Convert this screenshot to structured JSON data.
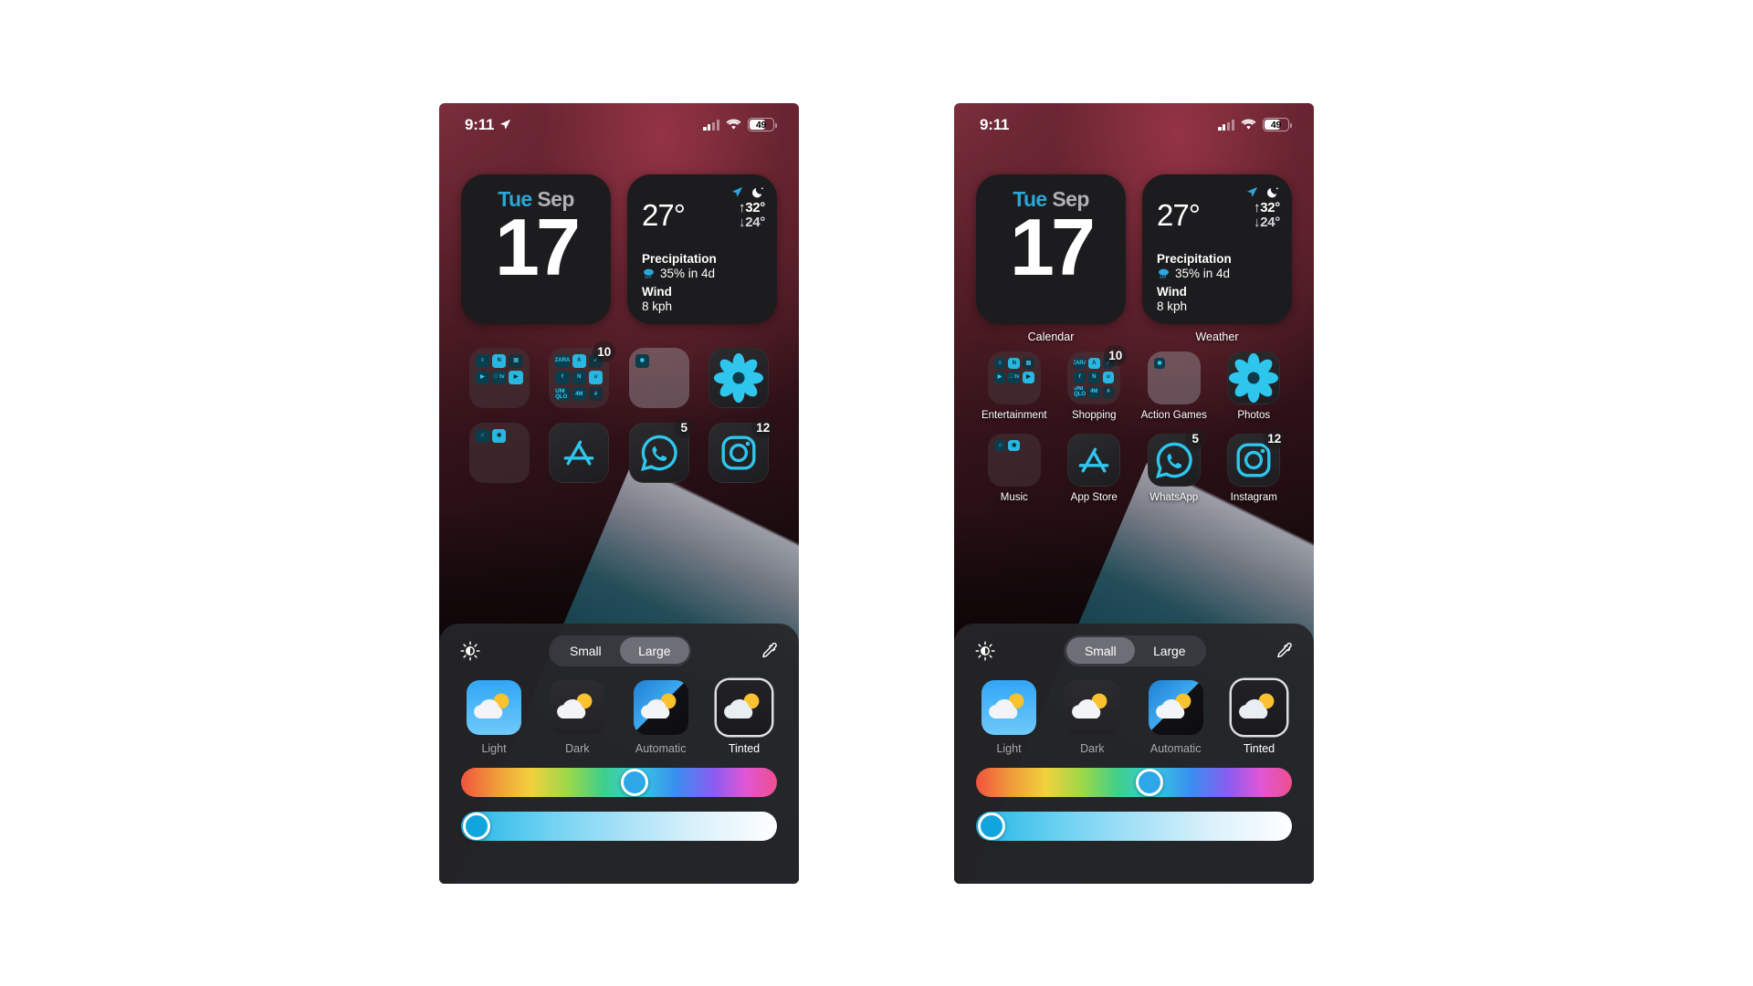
{
  "screens": [
    {
      "id": "left",
      "name": "home-screen-large-icons-no-labels",
      "status_bar": {
        "time": "9:11",
        "location_icon": "location-arrow-icon",
        "signal_icon": "cellular-signal-icon",
        "wifi_icon": "wifi-icon",
        "battery_level": "49"
      },
      "widgets": [
        {
          "name": "calendar-widget",
          "label": "",
          "day_of_week": "Tue",
          "month": "Sep",
          "day": "17"
        },
        {
          "name": "weather-widget",
          "label": "",
          "temperature": "27°",
          "high": "↑32°",
          "low": "↓24°",
          "precipitation_title": "Precipitation",
          "precipitation_value": "35% in 4d",
          "wind_title": "Wind",
          "wind_value": "8 kph",
          "location_icon": "location-arrow-icon",
          "condition_icon": "moon-stars-icon",
          "precip_icon": "rain-cloud-icon"
        }
      ],
      "apps": [
        {
          "name": "entertainment-folder",
          "label": "",
          "badge": "",
          "type": "folder",
          "tiles": [
            "≡",
            "N",
            "▤",
            "▶",
            " tv",
            "▶",
            "",
            "",
            ""
          ]
        },
        {
          "name": "shopping-folder",
          "label": "",
          "badge": "10",
          "type": "folder",
          "tiles": [
            "ZARA",
            "Λ",
            "✓",
            "f",
            "N",
            "∪",
            "UNI QLO",
            "4M",
            "#"
          ]
        },
        {
          "name": "action-games-folder",
          "label": "",
          "badge": "",
          "type": "folder-light",
          "tiles": [
            "◉",
            "",
            "",
            "",
            "",
            "",
            "",
            "",
            ""
          ]
        },
        {
          "name": "photos-app",
          "label": "",
          "badge": "",
          "type": "photos"
        },
        {
          "name": "music-folder",
          "label": "",
          "badge": "",
          "type": "folder",
          "tiles": [
            "♫",
            "◉",
            "",
            "",
            "",
            "",
            "",
            "",
            ""
          ]
        },
        {
          "name": "app-store-app",
          "label": "",
          "badge": "",
          "type": "appstore"
        },
        {
          "name": "whatsapp-app",
          "label": "",
          "badge": "5",
          "type": "whatsapp"
        },
        {
          "name": "instagram-app",
          "label": "",
          "badge": "12",
          "type": "instagram"
        }
      ],
      "panel": {
        "brightness_icon": "brightness-icon",
        "eyedropper_icon": "eyedropper-icon",
        "size_options": [
          "Small",
          "Large"
        ],
        "size_selected": "Large",
        "themes": [
          {
            "name": "Light",
            "selected": false
          },
          {
            "name": "Dark",
            "selected": false
          },
          {
            "name": "Automatic",
            "selected": false
          },
          {
            "name": "Tinted",
            "selected": true
          }
        ],
        "hue_slider": {
          "name": "hue-slider",
          "position_pct": 55
        },
        "luminance_slider": {
          "name": "luminance-slider",
          "position_pct": 5
        }
      }
    },
    {
      "id": "right",
      "name": "home-screen-small-icons-with-labels",
      "status_bar": {
        "time": "9:11",
        "location_icon": "",
        "signal_icon": "cellular-signal-icon",
        "wifi_icon": "wifi-icon",
        "battery_level": "49"
      },
      "widgets": [
        {
          "name": "calendar-widget",
          "label": "Calendar",
          "day_of_week": "Tue",
          "month": "Sep",
          "day": "17"
        },
        {
          "name": "weather-widget",
          "label": "Weather",
          "temperature": "27°",
          "high": "↑32°",
          "low": "↓24°",
          "precipitation_title": "Precipitation",
          "precipitation_value": "35% in 4d",
          "wind_title": "Wind",
          "wind_value": "8 kph",
          "location_icon": "location-arrow-icon",
          "condition_icon": "moon-stars-icon",
          "precip_icon": "rain-cloud-icon"
        }
      ],
      "apps": [
        {
          "name": "entertainment-folder",
          "label": "Entertainment",
          "badge": "",
          "type": "folder",
          "tiles": [
            "≡",
            "N",
            "▤",
            "▶",
            " tv",
            "▶",
            "",
            "",
            ""
          ]
        },
        {
          "name": "shopping-folder",
          "label": "Shopping",
          "badge": "10",
          "type": "folder",
          "tiles": [
            "ZARA",
            "Λ",
            "✓",
            "f",
            "N",
            "∪",
            "UNI QLO",
            "4M",
            "#"
          ]
        },
        {
          "name": "action-games-folder",
          "label": "Action Games",
          "badge": "",
          "type": "folder-light",
          "tiles": [
            "◉",
            "",
            "",
            "",
            "",
            "",
            "",
            "",
            ""
          ]
        },
        {
          "name": "photos-app",
          "label": "Photos",
          "badge": "",
          "type": "photos"
        },
        {
          "name": "music-folder",
          "label": "Music",
          "badge": "",
          "type": "folder",
          "tiles": [
            "♫",
            "◉",
            "",
            "",
            "",
            "",
            "",
            "",
            ""
          ]
        },
        {
          "name": "app-store-app",
          "label": "App Store",
          "badge": "",
          "type": "appstore"
        },
        {
          "name": "whatsapp-app",
          "label": "WhatsApp",
          "badge": "5",
          "type": "whatsapp"
        },
        {
          "name": "instagram-app",
          "label": "Instagram",
          "badge": "12",
          "type": "instagram"
        }
      ],
      "panel": {
        "brightness_icon": "brightness-icon",
        "eyedropper_icon": "eyedropper-icon",
        "size_options": [
          "Small",
          "Large"
        ],
        "size_selected": "Small",
        "themes": [
          {
            "name": "Light",
            "selected": false
          },
          {
            "name": "Dark",
            "selected": false
          },
          {
            "name": "Automatic",
            "selected": false
          },
          {
            "name": "Tinted",
            "selected": true
          }
        ],
        "hue_slider": {
          "name": "hue-slider",
          "position_pct": 55
        },
        "luminance_slider": {
          "name": "luminance-slider",
          "position_pct": 5
        }
      }
    }
  ]
}
